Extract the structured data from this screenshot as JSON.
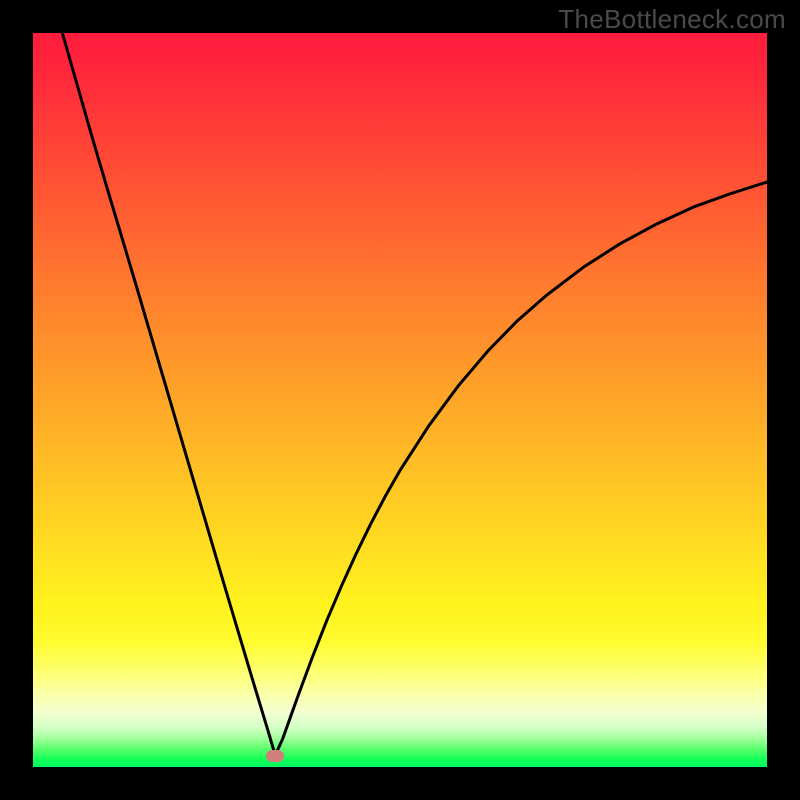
{
  "watermark": "TheBottleneck.com",
  "chart_data": {
    "type": "line",
    "title": "",
    "xlabel": "",
    "ylabel": "",
    "xlim": [
      0,
      100
    ],
    "ylim": [
      0,
      100
    ],
    "grid": false,
    "minimum_point": {
      "x": 33,
      "y": 1.5
    },
    "series": [
      {
        "name": "bottleneck-curve",
        "color": "#000000",
        "x": [
          4,
          6,
          8,
          10,
          12,
          14,
          16,
          18,
          20,
          22,
          24,
          26,
          28,
          30,
          31,
          32,
          33,
          34,
          35,
          36,
          38,
          40,
          42,
          44,
          46,
          48,
          50,
          54,
          58,
          62,
          66,
          70,
          75,
          80,
          85,
          90,
          95,
          100
        ],
        "y": [
          100,
          93,
          86,
          79.2,
          72.5,
          65.8,
          59,
          52.2,
          45.4,
          38.6,
          31.8,
          25,
          18.3,
          11.6,
          8.3,
          5,
          1.6,
          3.8,
          6.6,
          9.4,
          14.8,
          19.9,
          24.6,
          29,
          33.1,
          36.9,
          40.4,
          46.6,
          52,
          56.7,
          60.8,
          64.3,
          68.1,
          71.3,
          74,
          76.3,
          78.1,
          79.7
        ]
      }
    ],
    "description": "A V-shaped bottleneck curve on a rainbow gradient (red=high, green=low). Curve drops steeply from top-left to a minimum near x≈33 at the bottom, then rises with a gentler concave curve toward x=100 at roughly 80% height."
  },
  "colors": {
    "background": "#000000",
    "curve": "#000000",
    "marker": "#d07f7a"
  }
}
